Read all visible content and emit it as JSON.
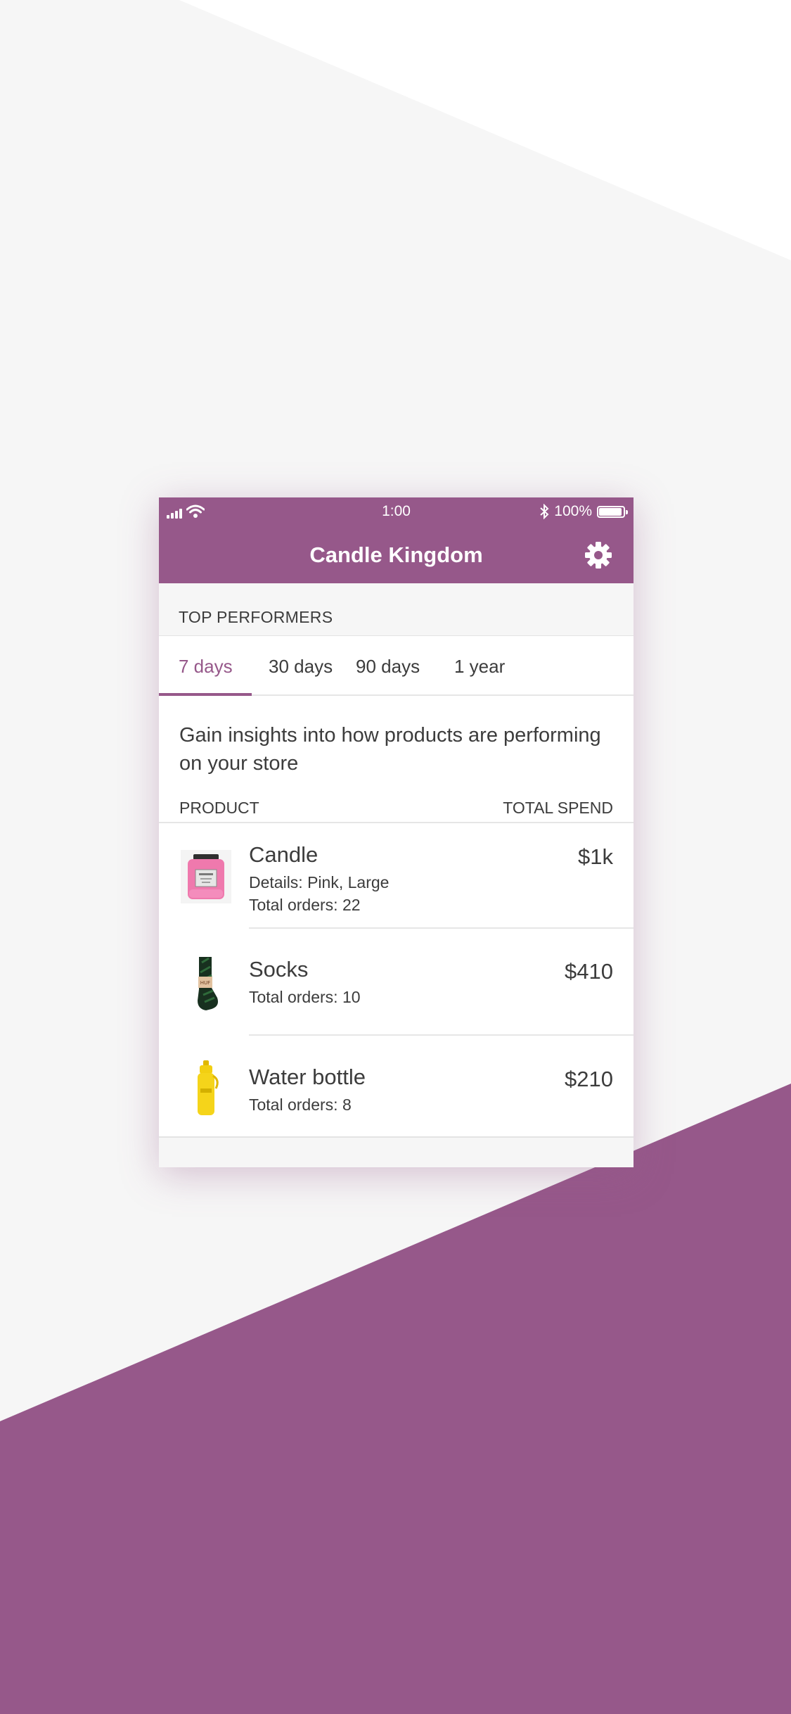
{
  "theme": {
    "accent": "#96588a",
    "text": "#3c3c3c",
    "background": "#f6f6f6"
  },
  "status_bar": {
    "time": "1:00",
    "battery": "100%",
    "battery_level": 1.0
  },
  "header": {
    "title": "Candle Kingdom",
    "settings_icon": "gear-icon"
  },
  "section": {
    "title": "TOP PERFORMERS"
  },
  "tabs": [
    {
      "label": "7 days",
      "active": true
    },
    {
      "label": "30 days",
      "active": false
    },
    {
      "label": "90 days",
      "active": false
    },
    {
      "label": "1 year",
      "active": false
    }
  ],
  "intro": "Gain insights into how products are performing on your store",
  "table": {
    "col_product": "PRODUCT",
    "col_spend": "TOTAL SPEND",
    "rows": [
      {
        "name": "Candle",
        "details": "Details: Pink, Large",
        "orders": "Total orders: 22",
        "spend": "$1k",
        "thumb": "candle-jar-image"
      },
      {
        "name": "Socks",
        "orders": "Total orders: 10",
        "spend": "$410",
        "thumb": "socks-image"
      },
      {
        "name": "Water bottle",
        "orders": "Total orders: 8",
        "spend": "$210",
        "thumb": "water-bottle-image"
      }
    ]
  }
}
